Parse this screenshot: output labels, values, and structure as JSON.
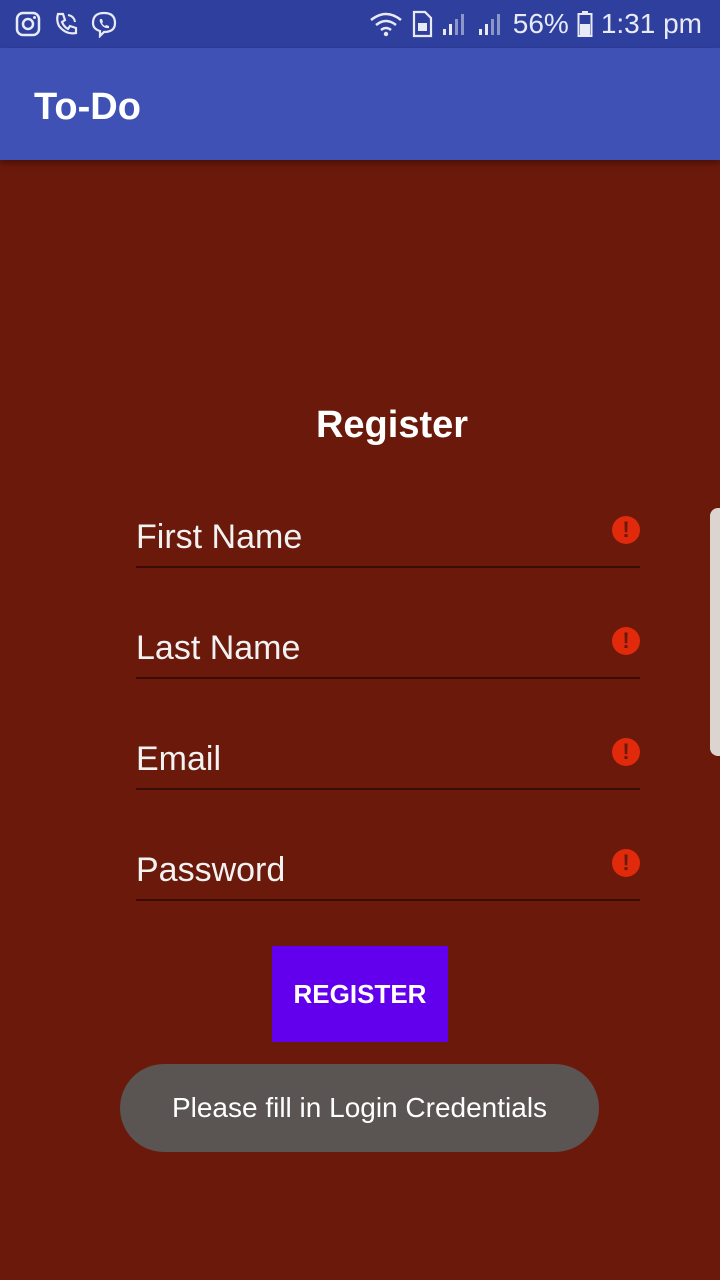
{
  "status_bar": {
    "left_icons": [
      "instagram-icon",
      "viber-call-icon",
      "viber-icon"
    ],
    "right_icons": [
      "wifi-icon",
      "sim-icon",
      "signal-icon-1",
      "signal-icon-2",
      "battery-icon"
    ],
    "battery_percent": "56%",
    "time": "1:31 pm"
  },
  "app_bar": {
    "title": "To-Do"
  },
  "form": {
    "title": "Register",
    "fields": [
      {
        "placeholder": "First Name"
      },
      {
        "placeholder": "Last Name"
      },
      {
        "placeholder": "Email"
      },
      {
        "placeholder": "Password"
      }
    ],
    "error_glyph": "!",
    "register_label": "REGISTER"
  },
  "toast": {
    "message": "Please fill in Login Credentials"
  },
  "colors": {
    "status_bar": "#2f3f9e",
    "app_bar": "#3f51b5",
    "background": "#6b190a",
    "button": "#6200ee",
    "error": "#e02a0b",
    "toast": "#5a5452"
  }
}
